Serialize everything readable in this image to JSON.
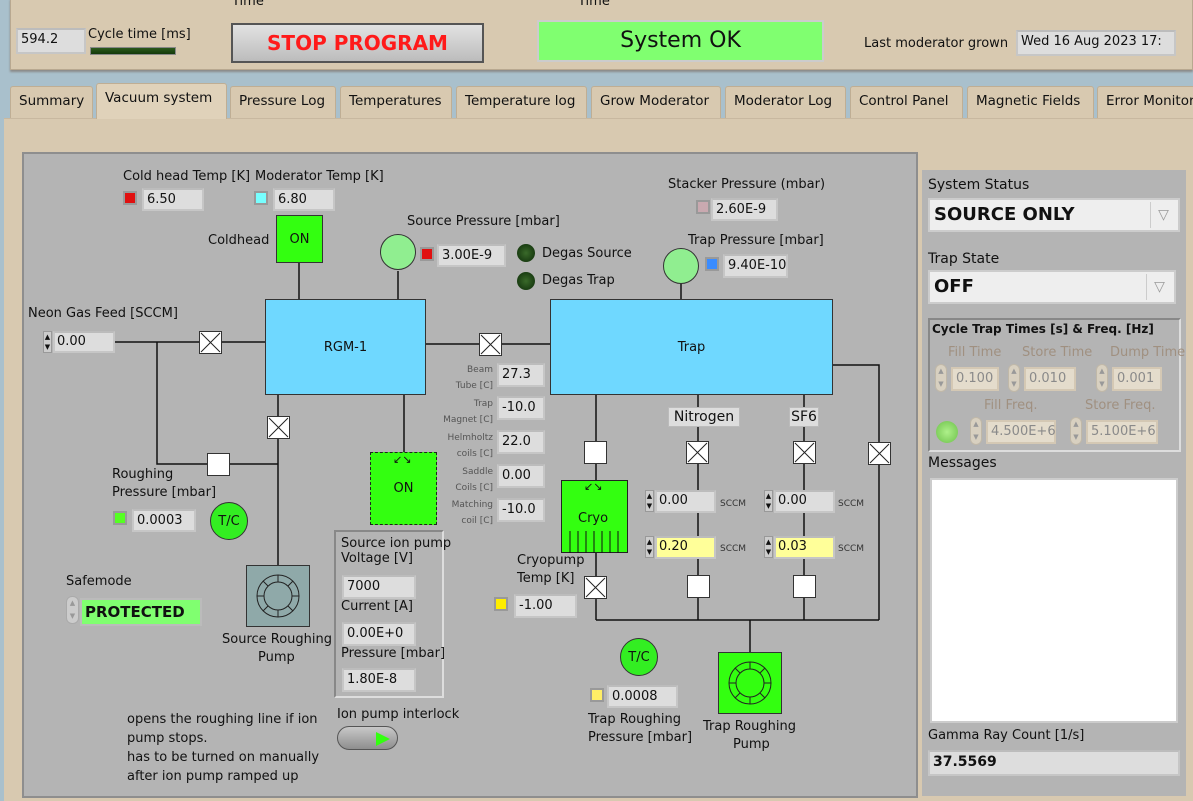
{
  "header": {
    "time_label_1": "Time",
    "time_label_2": "Time",
    "cycle_time_value": "594.2",
    "cycle_time_label": "Cycle time [ms]",
    "stop_button": "STOP PROGRAM",
    "system_status": "System OK",
    "last_moderator_label": "Last moderator grown",
    "last_moderator_value": "Wed 16 Aug 2023 17:"
  },
  "tabs": [
    "Summary",
    "Vacuum system",
    "Pressure Log",
    "Temperatures",
    "Temperature log",
    "Grow Moderator",
    "Moderator Log",
    "Control Panel",
    "Magnetic Fields",
    "Error Monitor"
  ],
  "active_tab": "Vacuum system",
  "diagram": {
    "cold_head_label": "Cold head Temp [K]",
    "cold_head_value": "6.50",
    "moderator_label": "Moderator Temp [K]",
    "moderator_value": "6.80",
    "coldhead_label": "Coldhead",
    "coldhead_state": "ON",
    "source_pressure_label": "Source Pressure [mbar]",
    "source_pressure_value": "3.00E-9",
    "degas_source": "Degas Source",
    "degas_trap": "Degas Trap",
    "stacker_label": "Stacker Pressure (mbar)",
    "stacker_value": "2.60E-9",
    "trap_pressure_label": "Trap Pressure [mbar]",
    "trap_pressure_value": "9.40E-10",
    "neon_label": "Neon Gas Feed [SCCM]",
    "neon_value": "0.00",
    "rgm_label": "RGM-1",
    "trap_label": "Trap",
    "roughing_label_1": "Roughing",
    "roughing_label_2": "Pressure [mbar]",
    "roughing_value": "0.0003",
    "tc_label": "T/C",
    "source_roughing_pump_1": "Source Roughing",
    "source_roughing_pump_2": "Pump",
    "ion_pump_state": "ON",
    "temps": [
      {
        "label1": "Beam",
        "label2": "Tube [C]",
        "value": "27.3"
      },
      {
        "label1": "Trap",
        "label2": "Magnet [C]",
        "value": "-10.0"
      },
      {
        "label1": "Helmholtz",
        "label2": "coils [C]",
        "value": "22.0"
      },
      {
        "label1": "Saddle",
        "label2": "Coils [C]",
        "value": "0.00"
      },
      {
        "label1": "Matching",
        "label2": "coil [C]",
        "value": "-10.0"
      }
    ],
    "cryo_label": "Cryo",
    "nitrogen_label": "Nitrogen",
    "sf6_label": "SF6",
    "sccm_unit": "SCCM",
    "nitrogen_actual": "0.00",
    "nitrogen_set": "0.20",
    "sf6_actual": "0.00",
    "sf6_set": "0.03",
    "cryopump_label_1": "Cryopump",
    "cryopump_label_2": "Temp [K]",
    "cryopump_value": "-1.00",
    "trap_roughing_label_1": "Trap Roughing",
    "trap_roughing_label_2": "Pressure [mbar]",
    "trap_roughing_value": "0.0008",
    "trap_roughing_pump_1": "Trap Roughing",
    "trap_roughing_pump_2": "Pump",
    "ion_pump_group": {
      "title_1": "Source ion pump",
      "voltage_label": "Voltage [V]",
      "voltage_value": "7000",
      "current_label": "Current [A]",
      "current_value": "0.00E+0",
      "pressure_label": "Pressure [mbar]",
      "pressure_value": "1.80E-8"
    },
    "safemode_label": "Safemode",
    "safemode_value": "PROTECTED",
    "note_1": "opens the roughing line if ion",
    "note_2": "pump stops.",
    "note_3": "has to be turned on manually",
    "note_4": "after ion pump ramped up",
    "interlock_label": "Ion pump interlock"
  },
  "right": {
    "system_status_label": "System Status",
    "system_status_value": "SOURCE ONLY",
    "trap_state_label": "Trap State",
    "trap_state_value": "OFF",
    "cycle_group_title": "Cycle Trap Times [s] & Freq. [Hz]",
    "fill_time_label": "Fill Time",
    "fill_time": "0.100",
    "store_time_label": "Store Time",
    "store_time": "0.010",
    "dump_time_label": "Dump Time",
    "dump_time": "0.001",
    "fill_freq_label": "Fill Freq.",
    "fill_freq": "4.500E+6",
    "store_freq_label": "Store Freq.",
    "store_freq": "5.100E+6",
    "messages_label": "Messages",
    "messages": "",
    "gamma_label": "Gamma Ray Count [1/s]",
    "gamma_value": "37.5569"
  },
  "colors": {
    "ok_green": "#80ff70",
    "stop_red": "#ff1a1a",
    "chamber_blue": "#6fd8ff",
    "active_green": "#33ff10",
    "setpoint_yellow": "#ffff99"
  }
}
